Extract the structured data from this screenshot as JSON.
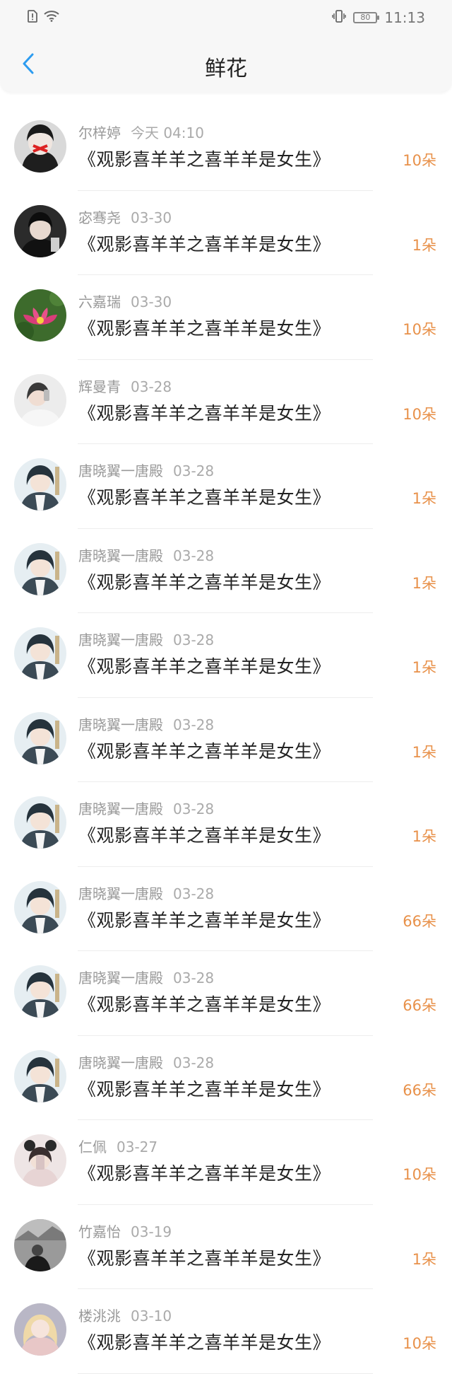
{
  "status_bar": {
    "time": "11:13",
    "battery": "80",
    "icons": [
      "sim-alert-icon",
      "wifi-icon",
      "vibrate-icon",
      "battery-icon"
    ]
  },
  "nav": {
    "title": "鲜花",
    "back_icon": "chevron-left-icon",
    "accent_color": "#2d9cf0"
  },
  "colors": {
    "amount": "#e8914a",
    "name": "#999999",
    "title": "#222222"
  },
  "items": [
    {
      "name": "尔梓婷",
      "date": "今天 04:10",
      "title": "《观影喜羊羊之喜羊羊是女生》",
      "amount": "10朵",
      "avatar": "avatar-dark-face"
    },
    {
      "name": "宓骞尧",
      "date": "03-30",
      "title": "《观影喜羊羊之喜羊羊是女生》",
      "amount": "1朵",
      "avatar": "avatar-boy-dark"
    },
    {
      "name": "六嘉瑞",
      "date": "03-30",
      "title": "《观影喜羊羊之喜羊羊是女生》",
      "amount": "10朵",
      "avatar": "avatar-lotus"
    },
    {
      "name": "辉曼青",
      "date": "03-28",
      "title": "《观影喜羊羊之喜羊羊是女生》",
      "amount": "10朵",
      "avatar": "avatar-girl-light"
    },
    {
      "name": "唐晓翼一唐殿",
      "date": "03-28",
      "title": "《观影喜羊羊之喜羊羊是女生》",
      "amount": "1朵",
      "avatar": "avatar-anime"
    },
    {
      "name": "唐晓翼一唐殿",
      "date": "03-28",
      "title": "《观影喜羊羊之喜羊羊是女生》",
      "amount": "1朵",
      "avatar": "avatar-anime"
    },
    {
      "name": "唐晓翼一唐殿",
      "date": "03-28",
      "title": "《观影喜羊羊之喜羊羊是女生》",
      "amount": "1朵",
      "avatar": "avatar-anime"
    },
    {
      "name": "唐晓翼一唐殿",
      "date": "03-28",
      "title": "《观影喜羊羊之喜羊羊是女生》",
      "amount": "1朵",
      "avatar": "avatar-anime"
    },
    {
      "name": "唐晓翼一唐殿",
      "date": "03-28",
      "title": "《观影喜羊羊之喜羊羊是女生》",
      "amount": "1朵",
      "avatar": "avatar-anime"
    },
    {
      "name": "唐晓翼一唐殿",
      "date": "03-28",
      "title": "《观影喜羊羊之喜羊羊是女生》",
      "amount": "66朵",
      "avatar": "avatar-anime"
    },
    {
      "name": "唐晓翼一唐殿",
      "date": "03-28",
      "title": "《观影喜羊羊之喜羊羊是女生》",
      "amount": "66朵",
      "avatar": "avatar-anime"
    },
    {
      "name": "唐晓翼一唐殿",
      "date": "03-28",
      "title": "《观影喜羊羊之喜羊羊是女生》",
      "amount": "66朵",
      "avatar": "avatar-anime"
    },
    {
      "name": "仁佩",
      "date": "03-27",
      "title": "《观影喜羊羊之喜羊羊是女生》",
      "amount": "10朵",
      "avatar": "avatar-girl-ears"
    },
    {
      "name": "竹嘉怡",
      "date": "03-19",
      "title": "《观影喜羊羊之喜羊羊是女生》",
      "amount": "1朵",
      "avatar": "avatar-bw-street"
    },
    {
      "name": "楼洮洮",
      "date": "03-10",
      "title": "《观影喜羊羊之喜羊羊是女生》",
      "amount": "10朵",
      "avatar": "avatar-blonde-girl"
    }
  ]
}
